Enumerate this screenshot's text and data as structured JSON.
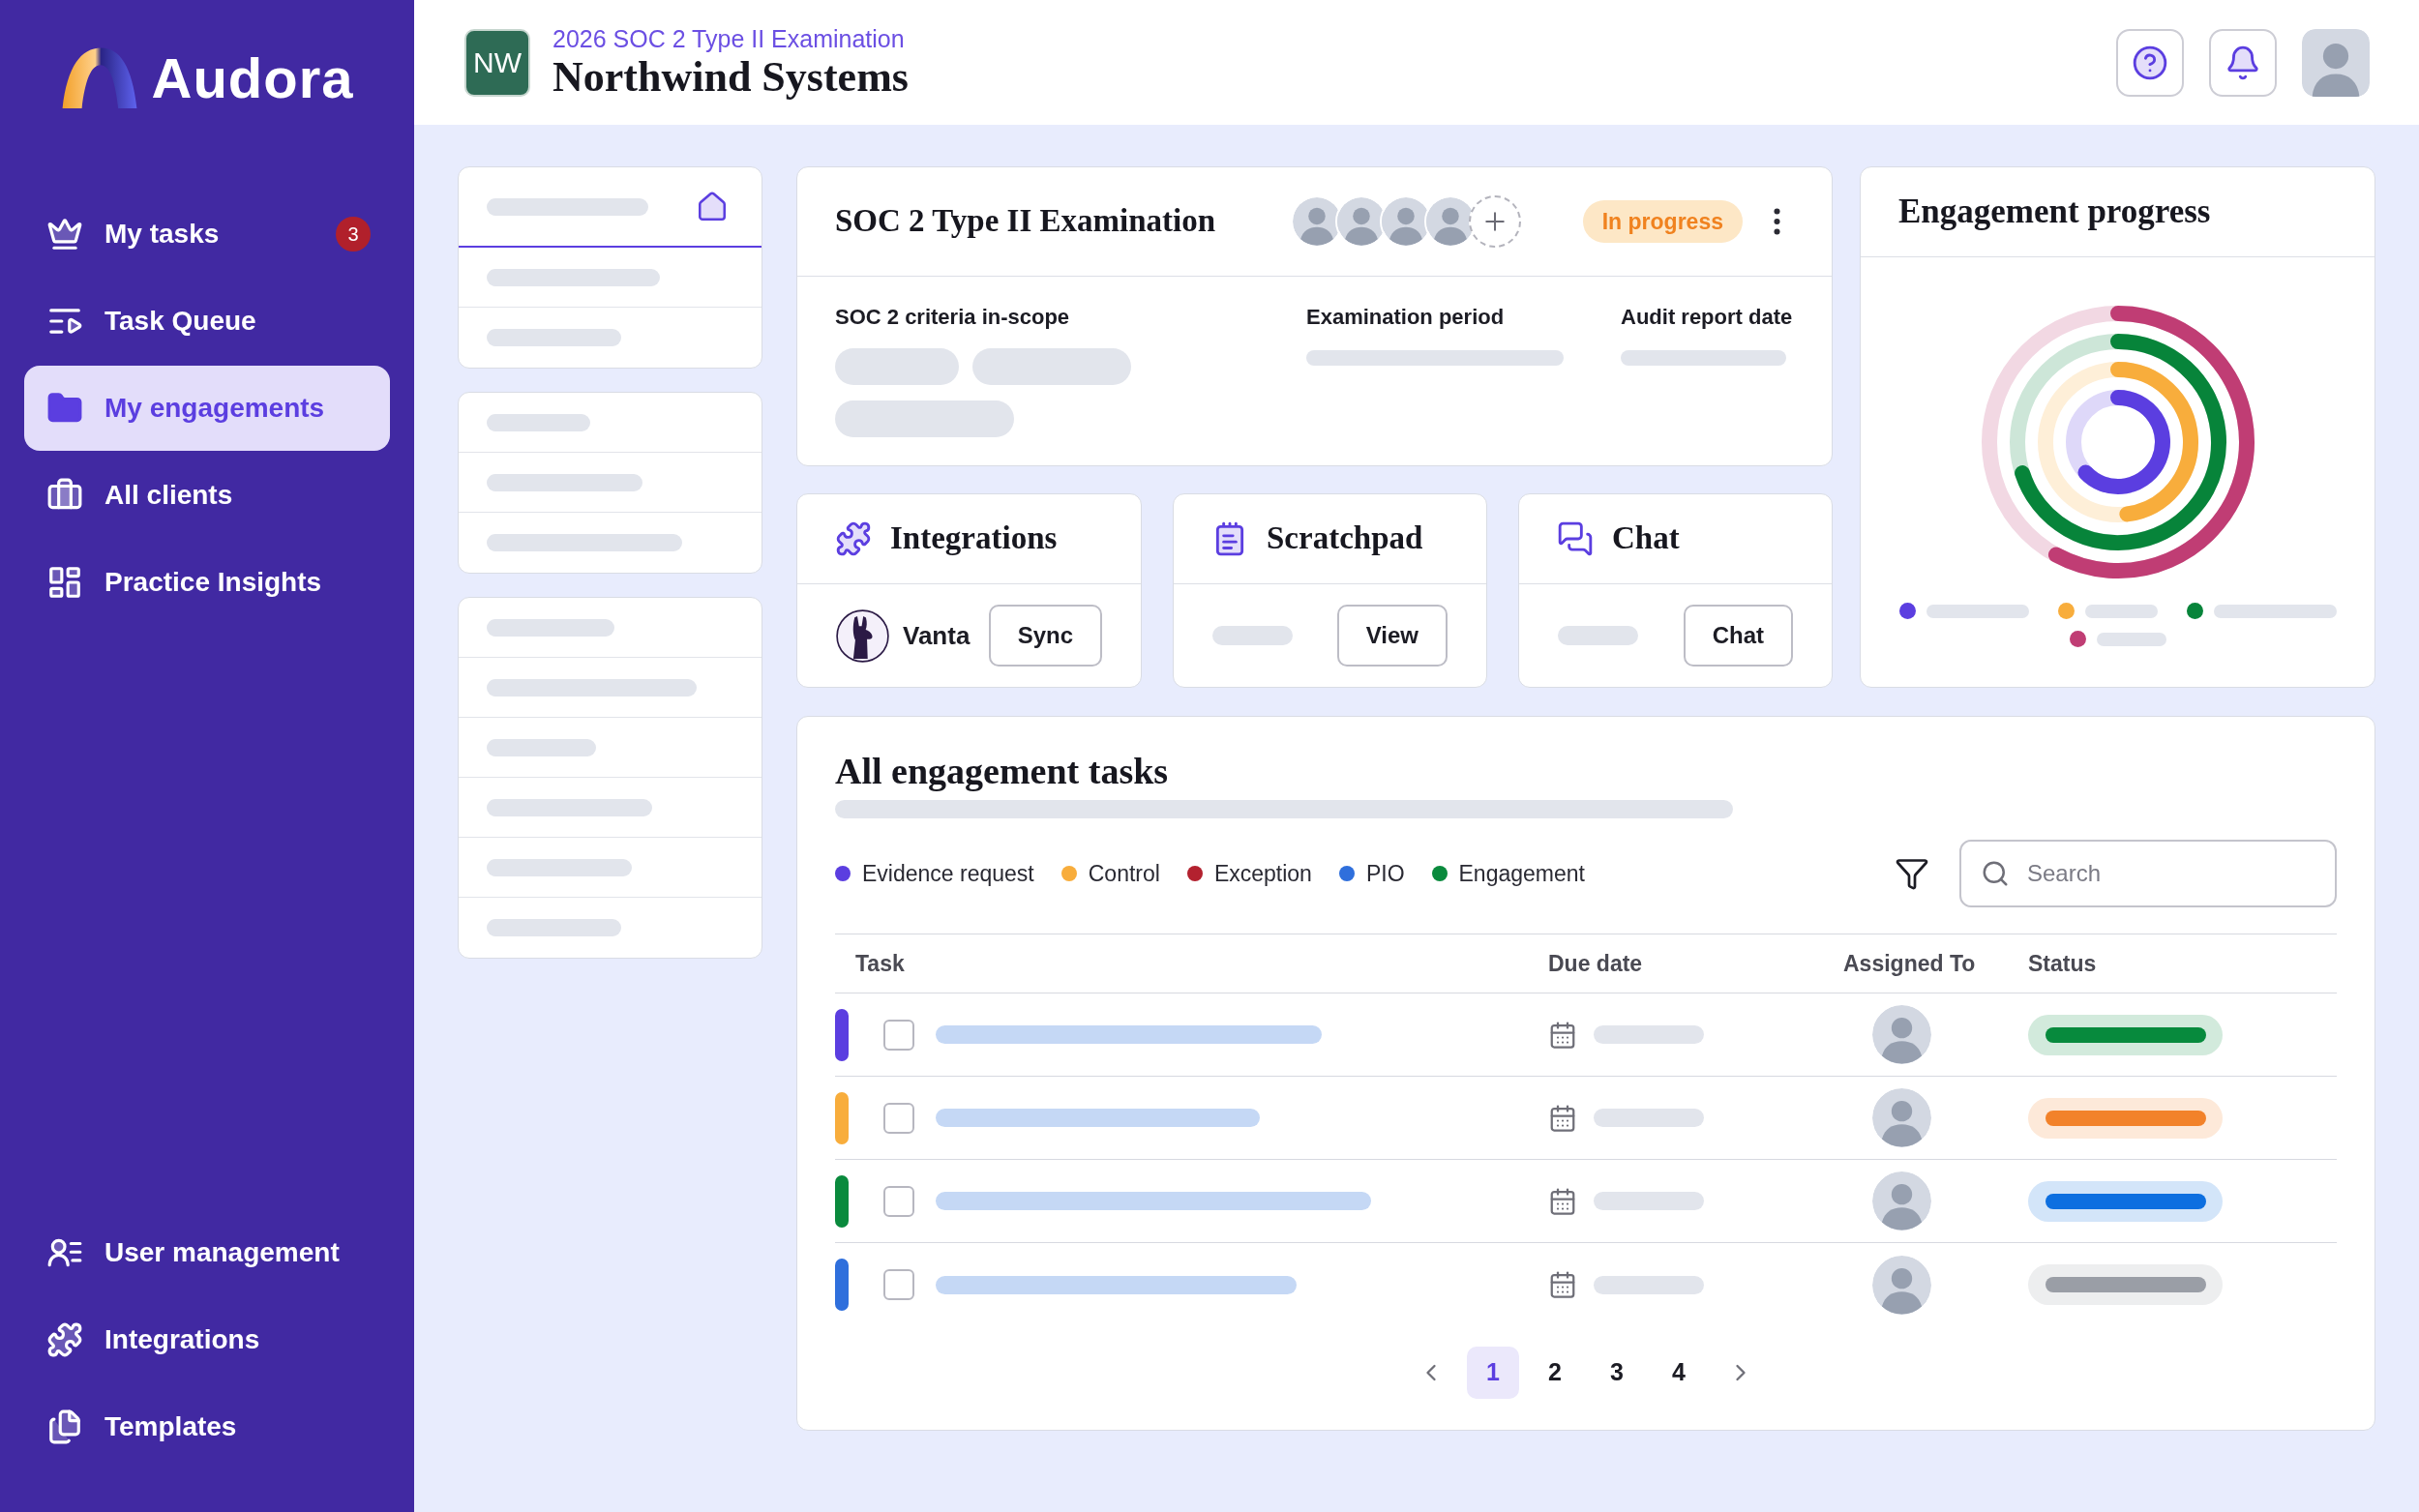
{
  "sidebar": {
    "brand": "Audora",
    "items": [
      {
        "label": "My tasks",
        "badge": "3",
        "selected": false
      },
      {
        "label": "Task Queue",
        "selected": false
      },
      {
        "label": "My engagements",
        "selected": true
      },
      {
        "label": "All clients",
        "selected": false
      },
      {
        "label": "Practice Insights",
        "selected": false
      }
    ],
    "bottom_items": [
      {
        "label": "User management",
        "selected": false
      },
      {
        "label": "Integrations",
        "selected": false
      },
      {
        "label": "Templates",
        "selected": false
      }
    ]
  },
  "header": {
    "initials": "NW",
    "subtitle": "2026 SOC 2 Type II Examination",
    "title": "Northwind Systems"
  },
  "section_nav": [
    {
      "rows": [
        {
          "kind": "home",
          "selected": true
        },
        {
          "kind": "bar",
          "selected": false
        },
        {
          "kind": "bar",
          "selected": false
        }
      ]
    },
    {
      "rows": [
        {
          "kind": "bar",
          "selected": false
        },
        {
          "kind": "bar",
          "selected": false
        },
        {
          "kind": "bar",
          "selected": false
        }
      ]
    },
    {
      "rows": [
        {
          "kind": "bar",
          "selected": false
        },
        {
          "kind": "bar",
          "selected": false
        },
        {
          "kind": "bar",
          "selected": false
        },
        {
          "kind": "bar",
          "selected": false
        },
        {
          "kind": "bar",
          "selected": false
        },
        {
          "kind": "bar",
          "selected": false
        }
      ]
    }
  ],
  "engagement": {
    "title": "SOC 2 Type II Examination",
    "status": "In progress",
    "fields": [
      {
        "label": "SOC 2 criteria in-scope",
        "kind": "tags"
      },
      {
        "label": "Examination period",
        "kind": "text"
      },
      {
        "label": "Audit report date",
        "kind": "text"
      }
    ]
  },
  "tools": [
    {
      "kind": "integrations",
      "title": "Integrations",
      "item": "Vanta",
      "button": "Sync"
    },
    {
      "kind": "scratchpad",
      "title": "Scratchpad",
      "button": "View"
    },
    {
      "kind": "chat",
      "title": "Chat",
      "button": "Chat"
    }
  ],
  "progress": {
    "title": "Engagement progress",
    "legend": [
      {
        "color": "#5b3ee0"
      },
      {
        "color": "#f8ad3c"
      },
      {
        "color": "#07843a"
      },
      {
        "color": "#c03d74"
      }
    ]
  },
  "tasks": {
    "title": "All engagement tasks",
    "legend": [
      {
        "label": "Evidence request",
        "color": "#5b3ee0"
      },
      {
        "label": "Control",
        "color": "#f8ad3c"
      },
      {
        "label": "Exception",
        "color": "#b3212f"
      },
      {
        "label": "PIO",
        "color": "#2f6fdc"
      },
      {
        "label": "Engagement",
        "color": "#0a8a3d"
      }
    ],
    "search": {
      "placeholder": "Search"
    },
    "columns": [
      "Task",
      "Due date",
      "Assigned To",
      "Status"
    ],
    "rows": [
      {
        "color": "#5b3ee0",
        "checked": false,
        "status": {
          "color": "#078a3d"
        }
      },
      {
        "color": "#f8ad3c",
        "checked": false,
        "status": {
          "color": "#f2822a"
        }
      },
      {
        "color": "#0a8a3d",
        "checked": false,
        "status": {
          "color": "#0d6fe0"
        }
      },
      {
        "color": "#2f6fdc",
        "checked": false,
        "status": {
          "color": "#9a9ea6"
        }
      }
    ],
    "pages": [
      {
        "label": "1",
        "selected": true
      },
      {
        "label": "2",
        "selected": false
      },
      {
        "label": "3",
        "selected": false
      },
      {
        "label": "4",
        "selected": false
      }
    ]
  }
}
